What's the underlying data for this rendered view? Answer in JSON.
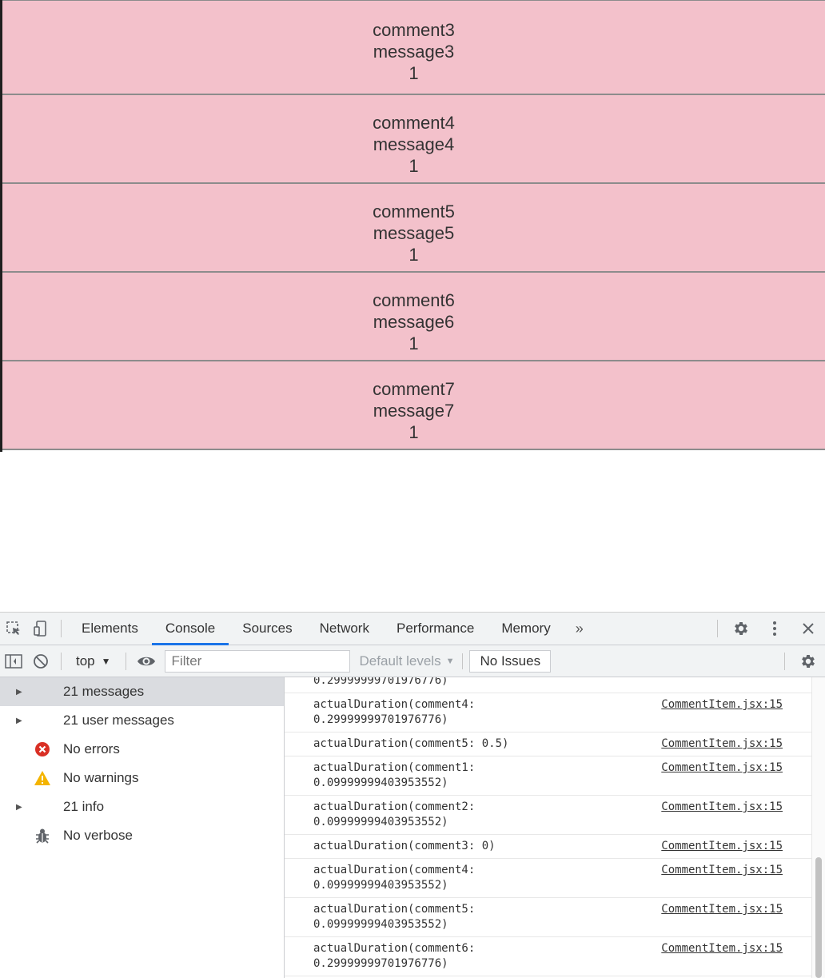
{
  "comments": [
    {
      "comment": "comment3",
      "message": "message3",
      "count": "1"
    },
    {
      "comment": "comment4",
      "message": "message4",
      "count": "1"
    },
    {
      "comment": "comment5",
      "message": "message5",
      "count": "1"
    },
    {
      "comment": "comment6",
      "message": "message6",
      "count": "1"
    },
    {
      "comment": "comment7",
      "message": "message7",
      "count": "1"
    }
  ],
  "devtools": {
    "tabs": [
      "Elements",
      "Console",
      "Sources",
      "Network",
      "Performance",
      "Memory"
    ],
    "active_tab": "Console",
    "more_tabs": "»",
    "toolbar": {
      "context": "top",
      "filter_placeholder": "Filter",
      "levels": "Default levels",
      "issues": "No Issues"
    },
    "sidebar": [
      {
        "label": "21 messages",
        "icon": "list-icon",
        "expandable": true
      },
      {
        "label": "21 user messages",
        "icon": "user-icon",
        "expandable": true
      },
      {
        "label": "No errors",
        "icon": "error-icon",
        "expandable": false
      },
      {
        "label": "No warnings",
        "icon": "warning-icon",
        "expandable": false
      },
      {
        "label": "21 info",
        "icon": "info-icon",
        "expandable": true
      },
      {
        "label": "No verbose",
        "icon": "bug-icon",
        "expandable": false
      }
    ],
    "messages": [
      {
        "text": "0.29999999701976776)",
        "source": ""
      },
      {
        "text": "actualDuration(comment4:\n0.29999999701976776)",
        "source": "CommentItem.jsx:15"
      },
      {
        "text": "actualDuration(comment5: 0.5)",
        "source": "CommentItem.jsx:15"
      },
      {
        "text": "actualDuration(comment1:\n0.09999999403953552)",
        "source": "CommentItem.jsx:15"
      },
      {
        "text": "actualDuration(comment2:\n0.09999999403953552)",
        "source": "CommentItem.jsx:15"
      },
      {
        "text": "actualDuration(comment3: 0)",
        "source": "CommentItem.jsx:15"
      },
      {
        "text": "actualDuration(comment4:\n0.09999999403953552)",
        "source": "CommentItem.jsx:15"
      },
      {
        "text": "actualDuration(comment5:\n0.09999999403953552)",
        "source": "CommentItem.jsx:15"
      },
      {
        "text": "actualDuration(comment6:\n0.29999999701976776)",
        "source": "CommentItem.jsx:15"
      }
    ],
    "colors": {
      "accent": "#1a73e8",
      "comment_bg": "#f3c1cb",
      "error": "#d93025",
      "warning": "#f4b400"
    }
  }
}
